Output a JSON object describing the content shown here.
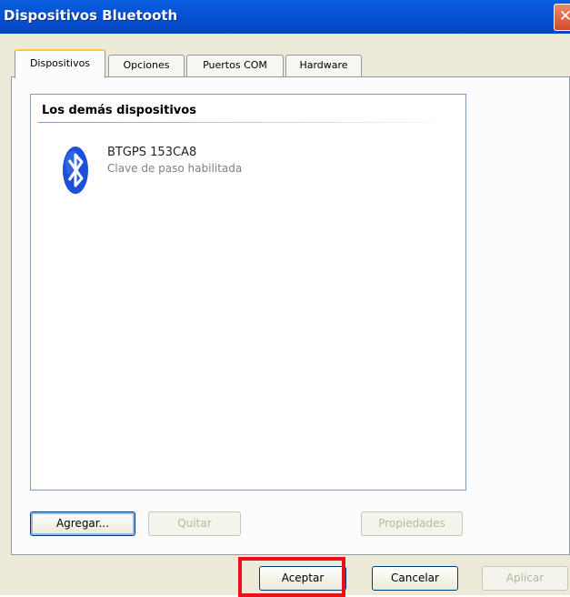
{
  "window": {
    "title": "Dispositivos Bluetooth",
    "close_glyph": "✕"
  },
  "tabs": [
    {
      "label": "Dispositivos",
      "active": true
    },
    {
      "label": "Opciones",
      "active": false
    },
    {
      "label": "Puertos COM",
      "active": false
    },
    {
      "label": "Hardware",
      "active": false
    }
  ],
  "device_list": {
    "group_header": "Los demás dispositivos",
    "devices": [
      {
        "name": "BTGPS 153CA8",
        "status": "Clave de paso habilitada",
        "icon": "bluetooth-icon"
      }
    ]
  },
  "panel_buttons": {
    "add": "Agregar...",
    "remove": "Quitar",
    "properties": "Propiedades"
  },
  "dialog_buttons": {
    "ok": "Aceptar",
    "cancel": "Cancelar",
    "apply": "Aplicar"
  },
  "colors": {
    "titlebar": "#0753d6",
    "highlight": "#e8101a",
    "bluetooth": "#1d4fd8"
  }
}
